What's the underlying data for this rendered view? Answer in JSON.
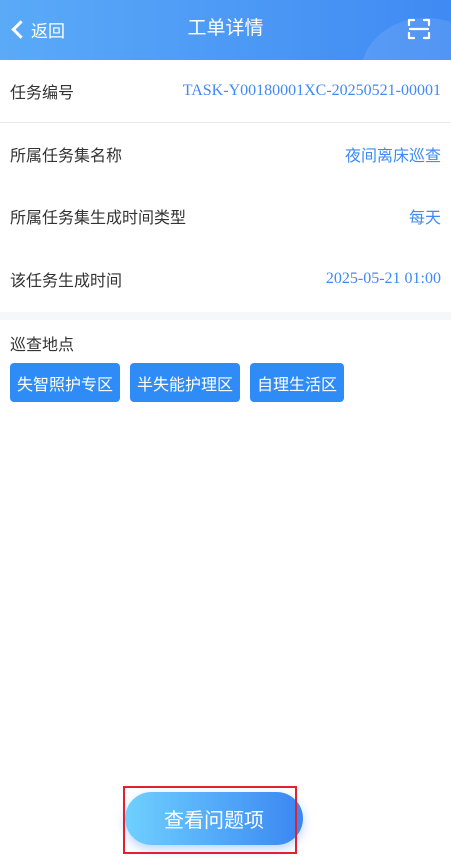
{
  "header": {
    "back_label": "返回",
    "title": "工单详情",
    "accent_color": "#3f8af3",
    "scan_icon": "scan-icon"
  },
  "details": [
    {
      "key": "任务编号",
      "value": "TASK-Y00180001XC-20250521-00001"
    },
    {
      "key": "所属任务集名称",
      "value": "夜间离床巡查"
    },
    {
      "key": "所属任务集生成时间类型",
      "value": "每天"
    },
    {
      "key": "该任务生成时间",
      "value": "2025-05-21 01:00"
    }
  ],
  "locations": {
    "title": "巡查地点",
    "tags": [
      "失智照护专区",
      "半失能护理区",
      "自理生活区"
    ],
    "tag_color": "#2f8bf5"
  },
  "action": {
    "view_issues_label": "查看问题项",
    "highlight_color": "#e2202f"
  }
}
